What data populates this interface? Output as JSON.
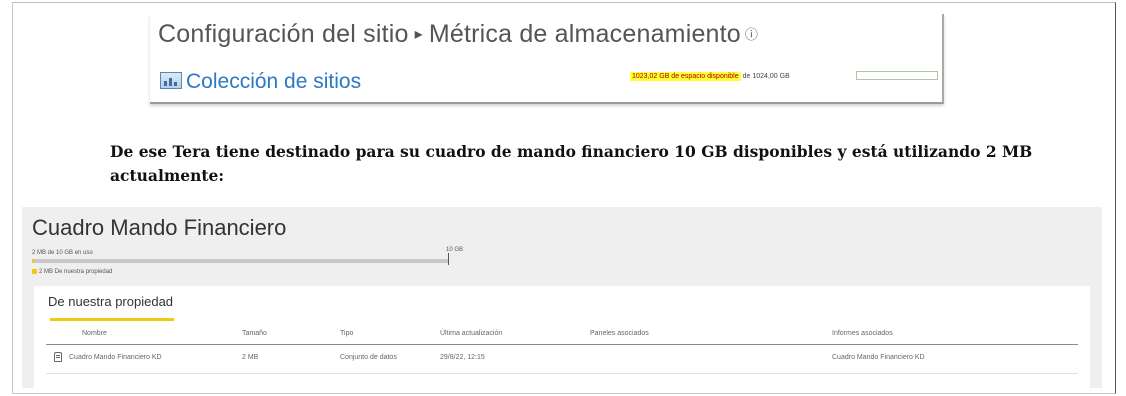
{
  "sharepoint": {
    "title_part1": "Configuración del sitio",
    "separator": "▸",
    "title_part2": "Métrica de almacenamiento",
    "info_icon": "info-icon",
    "collection_link": "Colección de sitios",
    "available_text": "1023,02 GB de espacio disponible",
    "total_text": "de 1024,00 GB",
    "usage_fraction": 0.0002,
    "highlight_color": "#ffff33",
    "link_color": "#2b78c5"
  },
  "paragraph": "De ese Tera tiene destinado para su cuadro de mando financiero 10 GB disponibles y está utilizando 2 MB actualmente:",
  "powerbi": {
    "title": "Cuadro Mando Financiero",
    "usage_text": "2 MB de 10 GB en uso",
    "capacity_label": "10 GB",
    "usage_fraction": 0.0002,
    "legend": "2 MB De nuestra propiedad",
    "accent_color": "#f2c811",
    "tab": "De nuestra propiedad",
    "columns": [
      "Nombre",
      "Tamaño",
      "Tipo",
      "Última actualización",
      "Paneles asociados",
      "Informes asociados"
    ],
    "rows": [
      {
        "icon": "dataset-icon",
        "name": "Cuadro Mando Financiero KD",
        "size": "2 MB",
        "type": "Conjunto de datos",
        "updated": "29/8/22, 12:15",
        "dashboards": "",
        "reports": "Cuadro Mando Financiero KD"
      }
    ]
  }
}
